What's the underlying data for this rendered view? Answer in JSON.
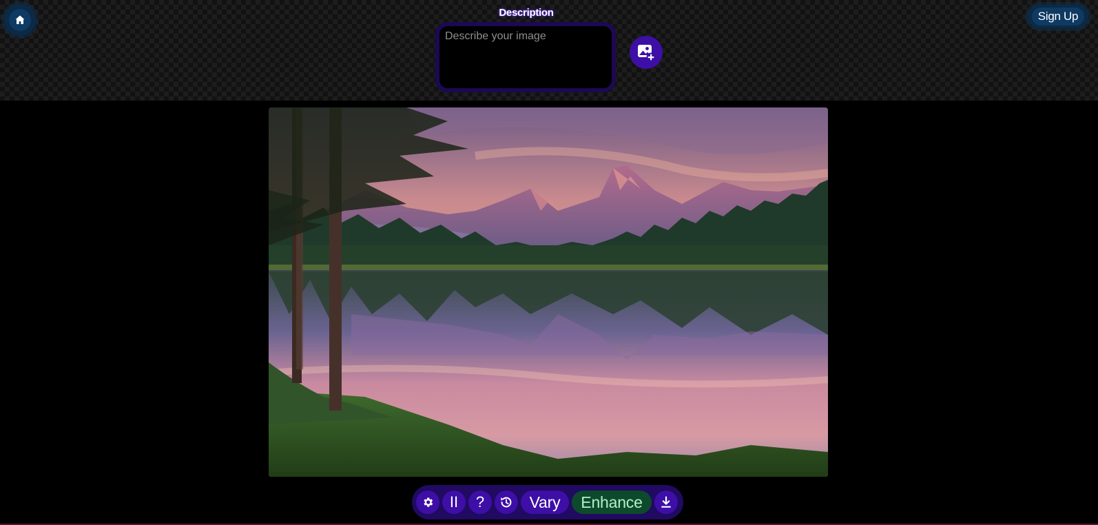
{
  "header": {
    "home_icon": "home-icon",
    "signup_label": "Sign Up",
    "description_label": "Description",
    "description_placeholder": "Describe your image",
    "description_value": "",
    "add_image_icon": "image-plus-icon"
  },
  "image": {
    "subject": "mountain lake landscape at sunset"
  },
  "toolbar": {
    "settings_icon": "gear-icon",
    "pause_label": "II",
    "help_label": "?",
    "history_icon": "history-icon",
    "vary_label": "Vary",
    "enhance_label": "Enhance",
    "download_icon": "download-icon"
  },
  "colors": {
    "primary_purple": "#3d0fa6",
    "toolbar_bg": "#200a62",
    "enhance_bg": "#0d4a2c",
    "enhance_text": "#aef2c8",
    "header_button_bg": "#0e3a63"
  }
}
